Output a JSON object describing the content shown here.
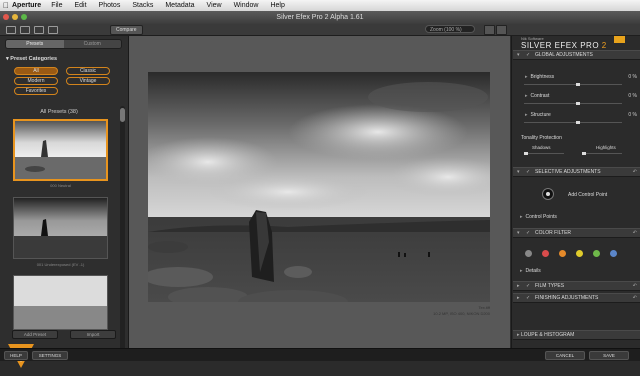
{
  "menubar": {
    "apple": "",
    "app": "Aperture",
    "items": [
      "File",
      "Edit",
      "Photos",
      "Stacks",
      "Metadata",
      "View",
      "Window",
      "Help"
    ]
  },
  "window": {
    "title": "Silver Efex Pro 2 Alpha 1.61"
  },
  "toolbar": {
    "compare_label": "Compare",
    "zoom_label": "Zoom (100 %)"
  },
  "left_panel": {
    "tabs": [
      "Presets",
      "Custom"
    ],
    "categories_header": "Preset Categories",
    "categories": [
      "All",
      "Classic",
      "Modern",
      "Vintage",
      "Favorites"
    ],
    "all_presets_label": "All Presets (38)",
    "thumbnails": [
      {
        "caption": "000 Neutral"
      },
      {
        "caption": "001 Underexposed (EV -1)"
      },
      {
        "caption": ""
      }
    ],
    "add_preset_label": "Add Preset",
    "import_label": "Import"
  },
  "photo": {
    "filename": "Tex.tiff",
    "meta": "10.2 MP, ISO 400, NIKON D200"
  },
  "right_panel": {
    "nik_label": "Nik Software",
    "brand": "SILVER EFEX PRO",
    "brand_version": "2",
    "global_header": "GLOBAL ADJUSTMENTS",
    "brightness_label": "Brightness",
    "brightness_value": "0 %",
    "contrast_label": "Contrast",
    "contrast_value": "0 %",
    "structure_label": "Structure",
    "structure_value": "0 %",
    "tonality_label": "Tonality Protection",
    "shadows_label": "Shadows",
    "highlights_label": "Highlights",
    "selective_header": "SELECTIVE ADJUSTMENTS",
    "add_control_point_label": "Add Control Point",
    "control_points_label": "Control Points",
    "color_filter_header": "COLOR FILTER",
    "filter_colors": [
      "#888888",
      "#d94c4c",
      "#e58a2a",
      "#e0cc2c",
      "#6fb84a",
      "#5b86c9"
    ],
    "details_label": "Details",
    "film_types_header": "FILM TYPES",
    "finishing_header": "FINISHING ADJUSTMENTS",
    "loupe_header": "LOUPE & HISTOGRAM"
  },
  "bottom": {
    "help_label": "HELP",
    "settings_label": "SETTINGS",
    "cancel_label": "CANCEL",
    "save_label": "SAVE"
  },
  "watermark": {
    "text": "video2brain"
  }
}
